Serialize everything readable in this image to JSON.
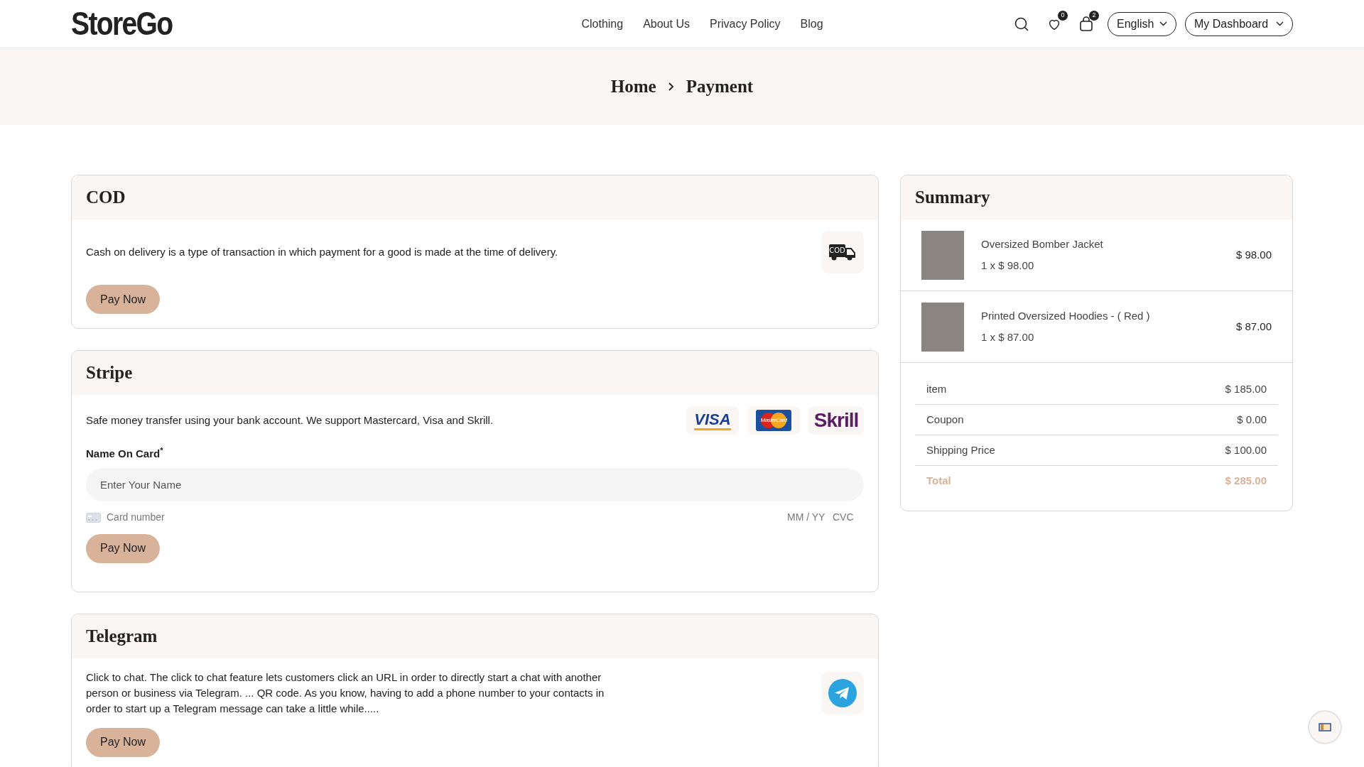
{
  "header": {
    "logo": "StoreGo",
    "nav": [
      "Clothing",
      "About Us",
      "Privacy Policy",
      "Blog"
    ],
    "wishlist_count": "0",
    "cart_count": "2",
    "language": "English",
    "dashboard": "My Dashboard"
  },
  "breadcrumb": [
    "Home",
    "Payment"
  ],
  "payment_methods": [
    {
      "kind": "cod",
      "title": "COD",
      "description": "Cash on delivery is a type of transaction in which payment for a good is made at the time of delivery.",
      "icon_label": "COD",
      "button": "Pay Now"
    },
    {
      "kind": "stripe",
      "title": "Stripe",
      "description": "Safe money transfer using your bank account. We support Mastercard, Visa and Skrill.",
      "logos": [
        "VISA",
        "MasterCard",
        "Skrill"
      ],
      "name_label": "Name On Card",
      "required_mark": "*",
      "name_placeholder": "Enter Your Name",
      "card_placeholder": "Card number",
      "expiry_placeholder": "MM / YY",
      "cvc_placeholder": "CVC",
      "button": "Pay Now"
    },
    {
      "kind": "telegram",
      "title": "Telegram",
      "description": "Click to chat. The click to chat feature lets customers click an URL in order to directly start a chat with another person or business via Telegram. ... QR code. As you know, having to add a phone number to your contacts in order to start up a Telegram message can take a little while.....",
      "button": "Pay Now"
    }
  ],
  "summary": {
    "title": "Summary",
    "items": [
      {
        "name": "Oversized Bomber Jacket",
        "quantity_price": "1 x $ 98.00",
        "price": "$ 98.00"
      },
      {
        "name": "Printed Oversized Hoodies - ( Red )",
        "quantity_price": "1 x $ 87.00",
        "price": "$ 87.00"
      }
    ],
    "totals": [
      {
        "kind": "line",
        "label": "item",
        "value": "$ 185.00"
      },
      {
        "kind": "line",
        "label": "Coupon",
        "value": "$ 0.00"
      },
      {
        "kind": "line",
        "label": "Shipping Price",
        "value": "$ 100.00"
      },
      {
        "kind": "total",
        "label": "Total",
        "value": "$ 285.00"
      }
    ]
  }
}
